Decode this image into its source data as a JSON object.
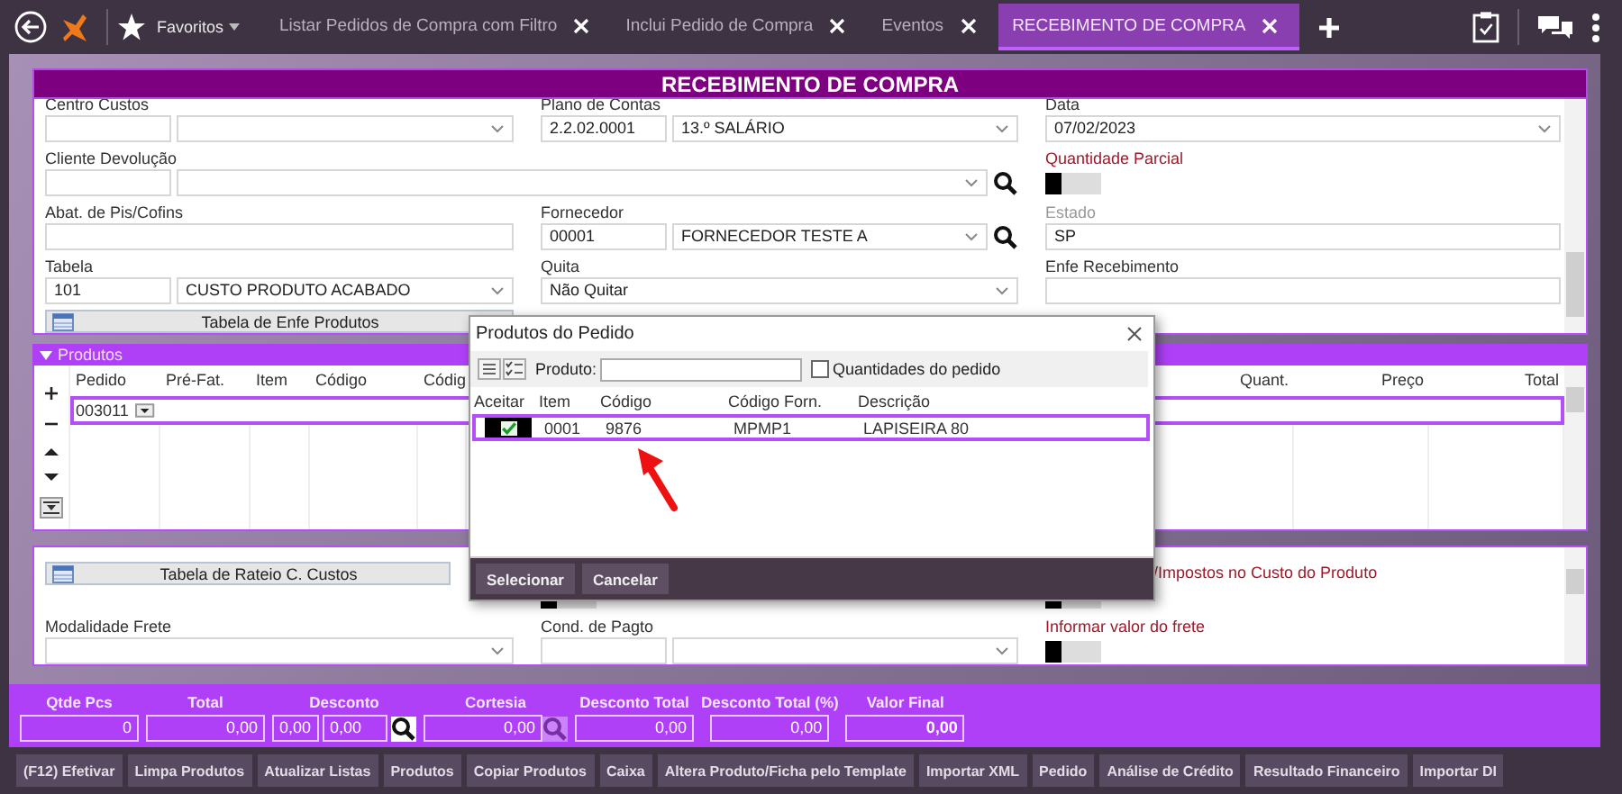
{
  "topbar": {
    "favorites": "Favoritos",
    "tabs": [
      {
        "label": "Listar Pedidos de Compra com Filtro",
        "selected": false
      },
      {
        "label": "Inclui Pedido de Compra",
        "selected": false
      },
      {
        "label": "Eventos",
        "selected": false
      },
      {
        "label": "RECEBIMENTO DE COMPRA",
        "selected": true
      }
    ]
  },
  "page_title": "RECEBIMENTO DE COMPRA",
  "form": {
    "fields": [
      {
        "label": "Centro Custos",
        "alert": false,
        "muted": false,
        "kind": "code-select",
        "wide": false,
        "search": false
      },
      {
        "label": "Plano de Contas",
        "alert": false,
        "muted": false,
        "kind": "code-select",
        "code": "2.2.02.0001",
        "value": "13.º SALÁRIO",
        "wide": false,
        "search": false
      },
      {
        "label": "Data",
        "alert": false,
        "muted": false,
        "kind": "select",
        "value": "07/02/2023",
        "wide": false
      },
      {
        "label": "Cliente Devolução",
        "alert": false,
        "muted": false,
        "kind": "code-select",
        "wide": true,
        "search": true
      },
      {
        "label": "Quantidade Parcial",
        "alert": true,
        "muted": false,
        "kind": "toggle",
        "on": false,
        "wide": false
      },
      {
        "label": "Abat. de Pis/Cofins",
        "alert": false,
        "muted": false,
        "kind": "text",
        "wide": false
      },
      {
        "label": "Fornecedor",
        "alert": false,
        "muted": false,
        "kind": "code-select",
        "code": "00001",
        "value": "FORNECEDOR TESTE A",
        "wide": false,
        "search": true
      },
      {
        "label": "Estado",
        "alert": false,
        "muted": true,
        "kind": "text",
        "value": "SP",
        "wide": false
      },
      {
        "label": "Tabela",
        "alert": false,
        "muted": false,
        "kind": "code-select",
        "code": "101",
        "value": "CUSTO PRODUTO ACABADO",
        "wide": false,
        "search": false
      },
      {
        "label": "Quita",
        "alert": false,
        "muted": false,
        "kind": "select",
        "value": "Não Quitar",
        "wide": false
      },
      {
        "label": "Enfe Recebimento",
        "alert": false,
        "muted": false,
        "kind": "text",
        "wide": false
      },
      {
        "kind": "button",
        "value": "Tabela de Enfe Produtos",
        "wide": false
      }
    ]
  },
  "products": {
    "title": "Produtos",
    "columns_left": [
      "Pedido",
      "Pré-Fat.",
      "Item",
      "Código",
      "Códig"
    ],
    "columns_right": [
      "Quant.",
      "Preço",
      "Total"
    ],
    "rows": [
      {
        "pedido": "003011",
        "selected": true
      }
    ]
  },
  "section2": {
    "fields": [
      {
        "kind": "button",
        "value": "Tabela de Rateio C. Custos"
      },
      {
        "kind": "toggle",
        "on": false
      },
      {
        "label": "/Impostos no Custo do Produto",
        "alert": true,
        "muted": false,
        "kind": "toggle",
        "on": false,
        "partly_covered": true
      },
      {
        "label": "Modalidade Frete",
        "alert": false,
        "muted": false,
        "kind": "select"
      },
      {
        "label": "Cond. de Pagto",
        "alert": false,
        "muted": false,
        "kind": "code-select",
        "search": false
      },
      {
        "label": "Informar valor do frete",
        "alert": true,
        "muted": false,
        "kind": "toggle",
        "on": false
      }
    ]
  },
  "totals": [
    {
      "label": "Qtde Pcs",
      "boxes": [
        "0"
      ]
    },
    {
      "label": "Total",
      "boxes": [
        "0,00"
      ]
    },
    {
      "label": "Desconto",
      "boxes": [
        "0,00",
        "0,00"
      ],
      "lookup": true,
      "lookup_dimmed": false
    },
    {
      "label": "Cortesia",
      "boxes": [
        "0,00"
      ],
      "lookup": true,
      "lookup_dimmed": true
    },
    {
      "label": "Desconto Total",
      "boxes": [
        "0,00"
      ]
    },
    {
      "label": "Desconto Total (%)",
      "boxes": [
        "0,00"
      ]
    },
    {
      "label": "Valor Final",
      "boxes": [
        "0,00"
      ],
      "emphasis": true
    }
  ],
  "actions": [
    "(F12) Efetivar",
    "Limpa Produtos",
    "Atualizar Listas",
    "Produtos",
    "Copiar Produtos",
    "Caixa",
    "Altera Produto/Ficha pelo Template",
    "Importar XML",
    "Pedido",
    "Análise de Crédito",
    "Resultado Financeiro",
    "Importar DI"
  ],
  "dialog": {
    "title": "Produtos do Pedido",
    "product_label": "Produto:",
    "quantities_label": "Quantidades do pedido",
    "quantities_checked": false,
    "check_column": "Aceitar",
    "columns": [
      "Item",
      "Código",
      "Código Forn.",
      "Descrição"
    ],
    "rows": [
      {
        "accepted": true,
        "selected": true,
        "cells": [
          "0001",
          "9876",
          "MPMP1",
          "LAPISEIRA 80"
        ]
      }
    ],
    "buttons": [
      "Selecionar",
      "Cancelar"
    ]
  }
}
